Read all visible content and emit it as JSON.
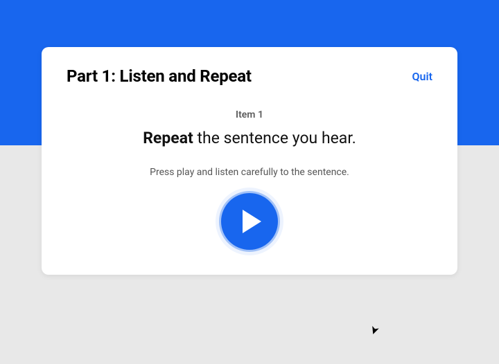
{
  "colors": {
    "brand": "#1866ee",
    "card_bg": "#ffffff",
    "page_bg": "#e8e8e8"
  },
  "header": {
    "title": "Part 1: Listen and Repeat",
    "quit_label": "Quit"
  },
  "content": {
    "item_label": "Item 1",
    "prompt_bold": "Repeat",
    "prompt_rest": " the sentence you hear.",
    "instruction": "Press play and listen carefully to the sentence."
  },
  "controls": {
    "play_button_label": "Play"
  }
}
